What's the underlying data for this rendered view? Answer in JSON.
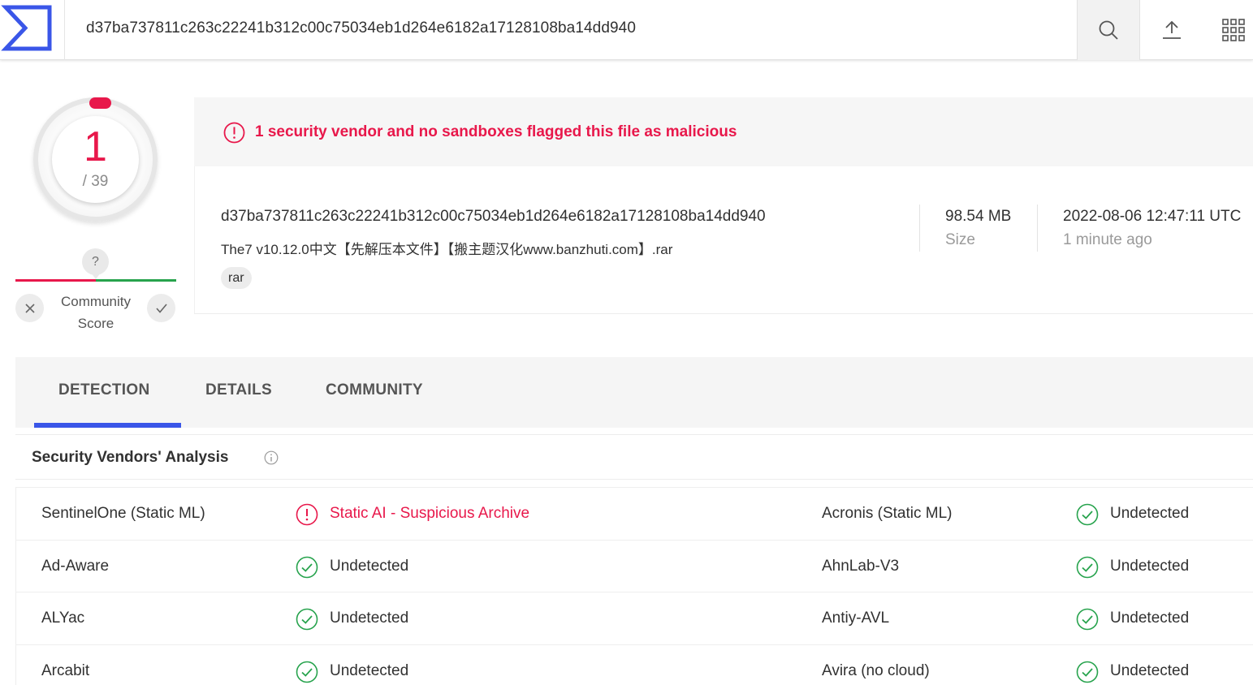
{
  "header": {
    "search_value": "d37ba737811c263c22241b312c00c75034eb1d264e6182a17128108ba14dd940",
    "icons": [
      "virustotal-logo",
      "search-icon",
      "upload-icon",
      "apps-grid-icon"
    ]
  },
  "score": {
    "detections": "1",
    "total": "/ 39",
    "community_label": "Community Score",
    "community_badge": "?"
  },
  "alert": {
    "text": "1 security vendor and no sandboxes flagged this file as malicious"
  },
  "file": {
    "hash": "d37ba737811c263c22241b312c00c75034eb1d264e6182a17128108ba14dd940",
    "name": "The7 v10.12.0中文【先解压本文件】【搬主题汉化www.banzhuti.com】.rar",
    "tag": "rar",
    "size_value": "98.54 MB",
    "size_label": "Size",
    "date_value": "2022-08-06 12:47:11 UTC",
    "date_label": "1 minute ago"
  },
  "tabs": [
    {
      "label": "DETECTION",
      "active": true
    },
    {
      "label": "DETAILS",
      "active": false
    },
    {
      "label": "COMMUNITY",
      "active": false
    }
  ],
  "analysis": {
    "title": "Security Vendors' Analysis",
    "rows": [
      {
        "left_vendor": "SentinelOne (Static ML)",
        "left_result": "Static AI - Suspicious Archive",
        "left_status": "malicious",
        "right_vendor": "Acronis (Static ML)",
        "right_result": "Undetected",
        "right_status": "clean"
      },
      {
        "left_vendor": "Ad-Aware",
        "left_result": "Undetected",
        "left_status": "clean",
        "right_vendor": "AhnLab-V3",
        "right_result": "Undetected",
        "right_status": "clean"
      },
      {
        "left_vendor": "ALYac",
        "left_result": "Undetected",
        "left_status": "clean",
        "right_vendor": "Antiy-AVL",
        "right_result": "Undetected",
        "right_status": "clean"
      },
      {
        "left_vendor": "Arcabit",
        "left_result": "Undetected",
        "left_status": "clean",
        "right_vendor": "Avira (no cloud)",
        "right_result": "Undetected",
        "right_status": "clean"
      }
    ]
  },
  "colors": {
    "malicious": "#e8184b",
    "clean": "#27a34d",
    "accent": "#3a56e8"
  }
}
